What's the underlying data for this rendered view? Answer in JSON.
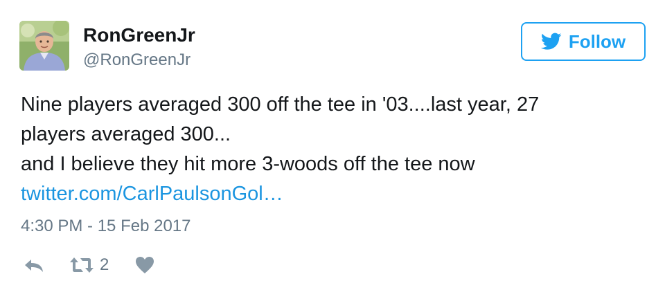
{
  "user": {
    "display_name": "RonGreenJr",
    "handle": "@RonGreenJr"
  },
  "follow_button": {
    "label": "Follow",
    "icon": "twitter-bird-icon"
  },
  "tweet": {
    "lines": [
      "Nine players averaged 300 off the tee in '03....last year, 27",
      "players averaged 300...",
      "and I believe they hit more 3-woods off the tee now"
    ],
    "link": "twitter.com/CarlPaulsonGol…",
    "timestamp": "4:30 PM - 15 Feb 2017"
  },
  "actions": {
    "reply_icon": "reply-icon",
    "retweet_icon": "retweet-icon",
    "retweet_count": "2",
    "like_icon": "heart-icon"
  },
  "colors": {
    "accent": "#1da1f2",
    "link": "#1b95e0",
    "secondary_text": "#657786",
    "action_icon": "#8899a6"
  }
}
